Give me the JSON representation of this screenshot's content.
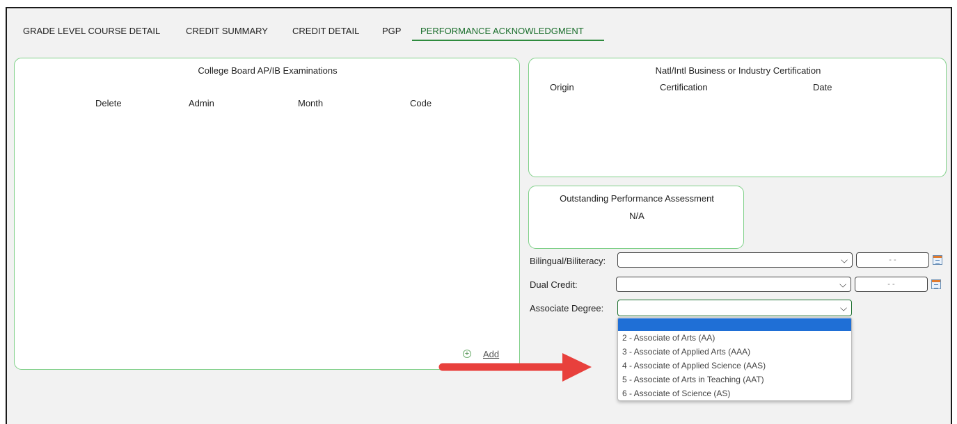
{
  "tabs": [
    {
      "label": "GRADE LEVEL COURSE DETAIL"
    },
    {
      "label": "CREDIT SUMMARY"
    },
    {
      "label": "CREDIT DETAIL"
    },
    {
      "label": "PGP"
    },
    {
      "label": "PERFORMANCE ACKNOWLEDGMENT",
      "active": true
    }
  ],
  "ap_ib": {
    "title": "College Board AP/IB Examinations",
    "columns": [
      "Delete",
      "Admin",
      "Month",
      "Code"
    ],
    "add_label": "Add"
  },
  "certification": {
    "title": "Natl/Intl Business or Industry Certification",
    "columns": [
      "Origin",
      "Certification",
      "Date"
    ]
  },
  "opa": {
    "title": "Outstanding Performance Assessment",
    "value": "N/A"
  },
  "fields": {
    "bilingual": {
      "label": "Bilingual/Biliteracy:",
      "value": "",
      "date": "- -"
    },
    "dual_credit": {
      "label": "Dual Credit:",
      "value": "",
      "date": "- -"
    },
    "associate_degree": {
      "label": "Associate Degree:",
      "value": ""
    }
  },
  "associate_degree_options": [
    "",
    "2 - Associate of Arts (AA)",
    "3 - Associate of Applied Arts (AAA)",
    "4 - Associate of Applied Science (AAS)",
    "5 - Associate of Arts in Teaching (AAT)",
    "6 - Associate of Science (AS)"
  ],
  "colors": {
    "accent_green": "#1a6e2c",
    "panel_border": "#7fd088",
    "selected_option": "#1f6fd6",
    "arrow": "#e8403c"
  },
  "icons": [
    "add-circle-icon",
    "chevron-down-icon",
    "calendar-icon",
    "red-arrow-annotation"
  ]
}
